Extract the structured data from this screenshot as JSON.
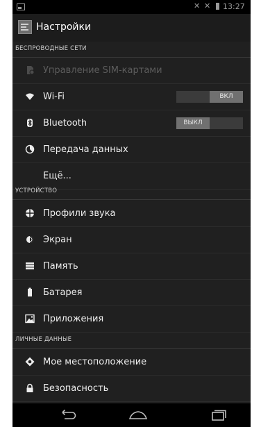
{
  "status": {
    "time": "13:27"
  },
  "header": {
    "title": "Настройки"
  },
  "sections": {
    "wireless": "БЕСПРОВОДНЫЕ СЕТИ",
    "device": "УСТРОЙСТВО",
    "personal": "ЛИЧНЫЕ ДАННЫЕ"
  },
  "items": {
    "sim": "Управление SIM-картами",
    "wifi": "Wi-Fi",
    "bluetooth": "Bluetooth",
    "data_usage": "Передача данных",
    "more": "Ещё...",
    "sound": "Профили звука",
    "display": "Экран",
    "storage": "Память",
    "battery": "Батарея",
    "apps": "Приложения",
    "location": "Мое местоположение",
    "security": "Безопасность"
  },
  "toggles": {
    "wifi": {
      "state": "on",
      "label": "ВКЛ"
    },
    "bluetooth": {
      "state": "off",
      "label": "ВЫКЛ"
    }
  },
  "icons": {
    "sim": "sim-card-icon",
    "wifi": "wifi-icon",
    "bluetooth": "bluetooth-icon",
    "data_usage": "data-usage-icon",
    "sound": "sound-icon",
    "display": "display-icon",
    "storage": "storage-icon",
    "battery": "battery-icon",
    "apps": "apps-icon",
    "location": "location-icon",
    "security": "lock-icon",
    "nav_back": "back-icon",
    "nav_home": "home-icon",
    "nav_recent": "recent-apps-icon"
  },
  "colors": {
    "background": "#202020",
    "text": "#ededed",
    "section_text": "#d0d0d0",
    "toggle_knob": "#707070"
  }
}
